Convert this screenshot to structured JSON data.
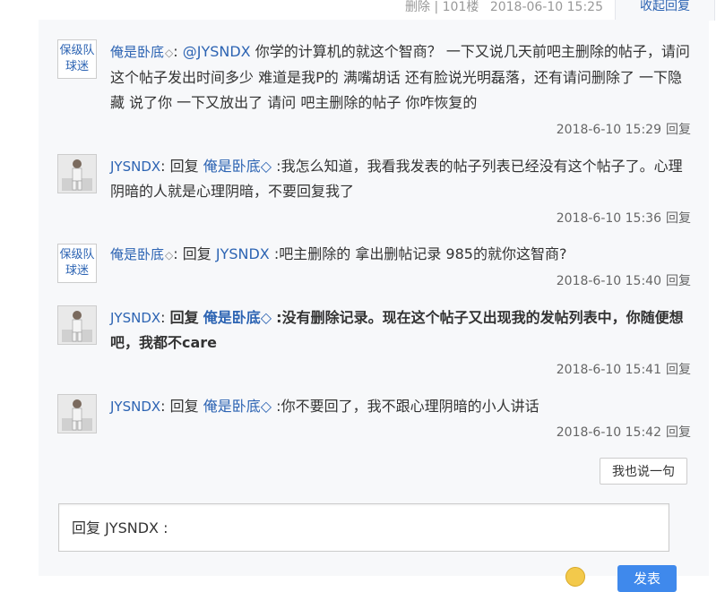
{
  "header": {
    "delete_label": "删除",
    "separator": "|",
    "floor": "101楼",
    "datetime": "2018-06-10 15:25",
    "collapse_label": "收起回复"
  },
  "replies": [
    {
      "user": "俺是卧底",
      "avatar_line1": "保级队",
      "avatar_line2": "球迷",
      "mention": "@JYSNDX",
      "text": " 你学的计算机的就这个智商？ 一下又说几天前吧主删除的帖子，请问这个帖子发出时间多少 难道是我P的 满嘴胡话 还有脸说光明磊落，还有请问删除了 一下隐藏 说了你 一下又放出了 请问 吧主删除的帖子 你咋恢复的",
      "time": "2018-6-10 15:29",
      "reply_label": "回复"
    },
    {
      "user": "JYSNDX",
      "reply_word": "回复",
      "target": "俺是卧底",
      "text": ":我怎么知道，我看我发表的帖子列表已经没有这个帖子了。心理阴暗的人就是心理阴暗，不要回复我了",
      "time": "2018-6-10 15:36",
      "reply_label": "回复"
    },
    {
      "user": "俺是卧底",
      "avatar_line1": "保级队",
      "avatar_line2": "球迷",
      "reply_word": "回复",
      "target": "JYSNDX",
      "text": ":吧主删除的 拿出删帖记录 985的就你这智商?",
      "time": "2018-6-10 15:40",
      "reply_label": "回复"
    },
    {
      "user": "JYSNDX",
      "reply_word": "回复",
      "target": "俺是卧底",
      "text": ":没有删除记录。现在这个帖子又出现我的发帖列表中，你随便想吧，我都不care",
      "time": "2018-6-10 15:41",
      "reply_label": "回复"
    },
    {
      "user": "JYSNDX",
      "reply_word": "回复",
      "target": "俺是卧底",
      "text": ":你不要回了，我不跟心理阴暗的小人讲话",
      "time": "2018-6-10 15:42",
      "reply_label": "回复"
    }
  ],
  "actions": {
    "say_label": "我也说一句",
    "reply_box_text": "回复 JYSNDX :",
    "submit_label": "发表"
  },
  "icons": {
    "diamond": "◇",
    "emoji": "smiley-icon"
  },
  "colors": {
    "link": "#2d64b3",
    "panel_bg": "#f7f8fa",
    "submit": "#3f89ec"
  }
}
